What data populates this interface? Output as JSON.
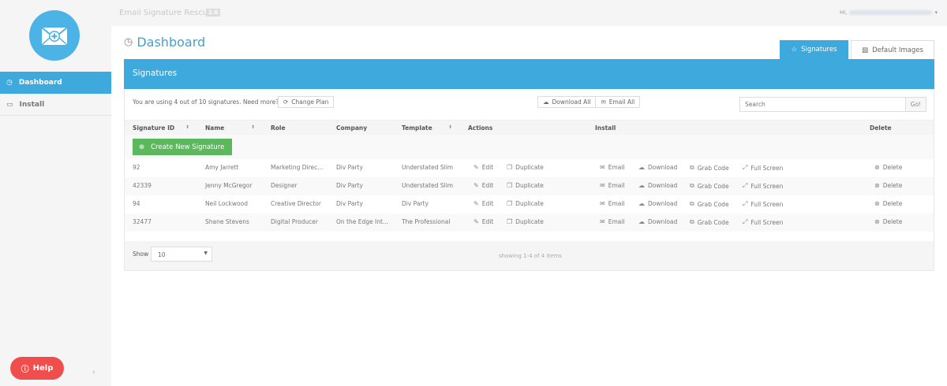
{
  "app": {
    "title": "Email Signature Rescue",
    "version": "2.0",
    "greeting": "Hi,",
    "accent": "#3da9dc",
    "success": "#5cb85c",
    "danger": "#f04d4d"
  },
  "sidebar": {
    "logo_icon": "envelope-plus-icon",
    "items": [
      {
        "label": "Dashboard",
        "icon": "dashboard-icon",
        "active": true
      },
      {
        "label": "Install",
        "icon": "monitor-icon",
        "active": false
      }
    ],
    "help_label": "Help",
    "collapse": "‹"
  },
  "page": {
    "title": "Dashboard",
    "tabs": [
      {
        "label": "Signatures",
        "icon": "star-icon",
        "active": true
      },
      {
        "label": "Default Images",
        "icon": "image-icon",
        "active": false
      }
    ]
  },
  "panel": {
    "title": "Signatures",
    "usage": "You are using 4 out of 10 signatures. Need more?",
    "change_plan": "Change Plan",
    "download_all": "Download All",
    "email_all": "Email All",
    "search_placeholder": "Search",
    "go": "Go!",
    "create": "Create New Signature"
  },
  "table": {
    "columns": [
      "Signature ID",
      "Name",
      "Role",
      "Company",
      "Template",
      "Actions",
      "Install",
      "Delete"
    ],
    "action_labels": {
      "edit": "Edit",
      "duplicate": "Duplicate",
      "email": "Email",
      "download": "Download",
      "grab": "Grab Code",
      "full": "Full Screen",
      "delete": "Delete"
    },
    "rows": [
      {
        "id": "92",
        "name": "Amy Jarrett",
        "role": "Marketing Direc...",
        "company": "Div Party",
        "template": "Understated Slim"
      },
      {
        "id": "42339",
        "name": "Jenny McGregor",
        "role": "Designer",
        "company": "Div Party",
        "template": "Understated Slim"
      },
      {
        "id": "94",
        "name": "Neil Lockwood",
        "role": "Creative Director",
        "company": "Div Party",
        "template": "Div Party"
      },
      {
        "id": "32477",
        "name": "Shane Stevens",
        "role": "Digital Producer",
        "company": "On the Edge Int...",
        "template": "The Professional"
      }
    ]
  },
  "footer": {
    "show_label": "Show",
    "show_value": "10",
    "showing": "showing 1-4 of 4 items"
  }
}
